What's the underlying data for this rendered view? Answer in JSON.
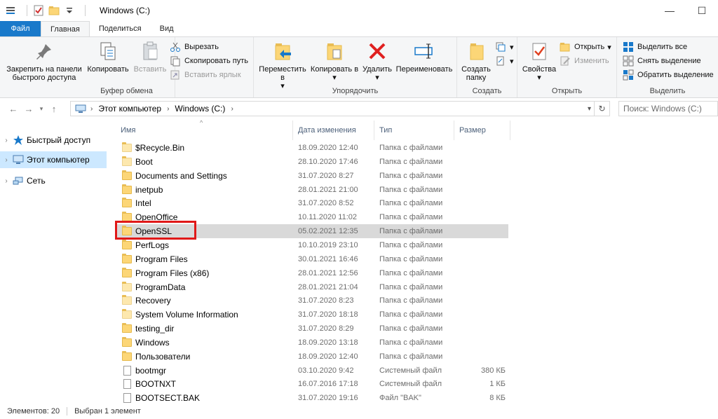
{
  "window": {
    "title": "Windows (C:)"
  },
  "ribbon_tabs": [
    "Файл",
    "Главная",
    "Поделиться",
    "Вид"
  ],
  "ribbon": {
    "clipboard": {
      "group_label": "Буфер обмена",
      "pin_label": "Закрепить на панели быстрого доступа",
      "copy_label": "Копировать",
      "paste_label": "Вставить",
      "cut_label": "Вырезать",
      "copy_path_label": "Скопировать путь",
      "paste_shortcut_label": "Вставить ярлык"
    },
    "organize": {
      "group_label": "Упорядочить",
      "move_label": "Переместить в",
      "copyto_label": "Копировать в",
      "delete_label": "Удалить",
      "rename_label": "Переименовать"
    },
    "new": {
      "group_label": "Создать",
      "new_folder_label": "Создать папку"
    },
    "open": {
      "group_label": "Открыть",
      "properties_label": "Свойства",
      "open_label": "Открыть",
      "edit_label": "Изменить"
    },
    "select": {
      "group_label": "Выделить",
      "select_all_label": "Выделить все",
      "select_none_label": "Снять выделение",
      "invert_label": "Обратить выделение"
    }
  },
  "address": {
    "breadcrumbs": [
      "Этот компьютер",
      "Windows (C:)"
    ],
    "search_placeholder": "Поиск: Windows (C:)"
  },
  "nav_pane": {
    "items": [
      "Быстрый доступ",
      "Этот компьютер",
      "Сеть"
    ]
  },
  "columns": {
    "name": "Имя",
    "date": "Дата изменения",
    "type": "Тип",
    "size": "Размер"
  },
  "files": [
    {
      "name": "$Recycle.Bin",
      "date": "18.09.2020 12:40",
      "type": "Папка с файлами",
      "size": "",
      "kind": "folder-light"
    },
    {
      "name": "Boot",
      "date": "28.10.2020 17:46",
      "type": "Папка с файлами",
      "size": "",
      "kind": "folder-light"
    },
    {
      "name": "Documents and Settings",
      "date": "31.07.2020 8:27",
      "type": "Папка с файлами",
      "size": "",
      "kind": "folder-shortcut"
    },
    {
      "name": "inetpub",
      "date": "28.01.2021 21:00",
      "type": "Папка с файлами",
      "size": "",
      "kind": "folder"
    },
    {
      "name": "Intel",
      "date": "31.07.2020 8:52",
      "type": "Папка с файлами",
      "size": "",
      "kind": "folder"
    },
    {
      "name": "OpenOffice",
      "date": "10.11.2020 11:02",
      "type": "Папка с файлами",
      "size": "",
      "kind": "folder"
    },
    {
      "name": "OpenSSL",
      "date": "05.02.2021 12:35",
      "type": "Папка с файлами",
      "size": "",
      "kind": "folder"
    },
    {
      "name": "PerfLogs",
      "date": "10.10.2019 23:10",
      "type": "Папка с файлами",
      "size": "",
      "kind": "folder"
    },
    {
      "name": "Program Files",
      "date": "30.01.2021 16:46",
      "type": "Папка с файлами",
      "size": "",
      "kind": "folder"
    },
    {
      "name": "Program Files (x86)",
      "date": "28.01.2021 12:56",
      "type": "Папка с файлами",
      "size": "",
      "kind": "folder"
    },
    {
      "name": "ProgramData",
      "date": "28.01.2021 21:04",
      "type": "Папка с файлами",
      "size": "",
      "kind": "folder-light"
    },
    {
      "name": "Recovery",
      "date": "31.07.2020 8:23",
      "type": "Папка с файлами",
      "size": "",
      "kind": "folder-light"
    },
    {
      "name": "System Volume Information",
      "date": "31.07.2020 18:18",
      "type": "Папка с файлами",
      "size": "",
      "kind": "folder-light"
    },
    {
      "name": "testing_dir",
      "date": "31.07.2020 8:29",
      "type": "Папка с файлами",
      "size": "",
      "kind": "folder"
    },
    {
      "name": "Windows",
      "date": "18.09.2020 13:18",
      "type": "Папка с файлами",
      "size": "",
      "kind": "folder"
    },
    {
      "name": "Пользователи",
      "date": "18.09.2020 12:40",
      "type": "Папка с файлами",
      "size": "",
      "kind": "folder"
    },
    {
      "name": "bootmgr",
      "date": "03.10.2020 9:42",
      "type": "Системный файл",
      "size": "380 КБ",
      "kind": "file"
    },
    {
      "name": "BOOTNXT",
      "date": "16.07.2016 17:18",
      "type": "Системный файл",
      "size": "1 КБ",
      "kind": "file"
    },
    {
      "name": "BOOTSECT.BAK",
      "date": "31.07.2020 19:16",
      "type": "Файл \"BAK\"",
      "size": "8 КБ",
      "kind": "file"
    }
  ],
  "selected_index": 6,
  "status": {
    "item_count": "Элементов: 20",
    "selection": "Выбран 1 элемент"
  },
  "colors": {
    "file_tab": "#1979ca",
    "selection": "#d9d9d9",
    "nav_selection": "#cce8ff",
    "highlight_box": "#e01818"
  }
}
